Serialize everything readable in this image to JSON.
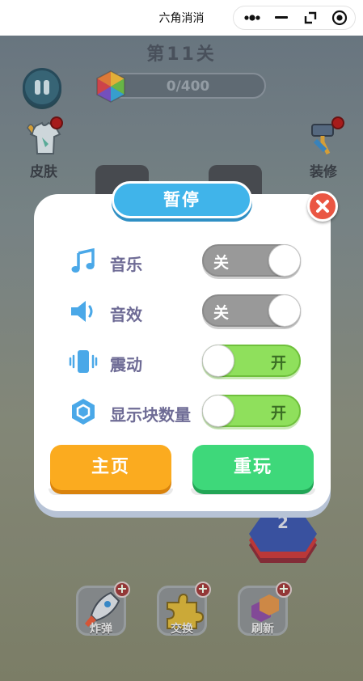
{
  "app": {
    "window_title": "六角消消"
  },
  "capsule": {
    "more_icon": "more-dots-icon",
    "minimize_icon": "minimize-icon",
    "restore_icon": "restore-icon",
    "close_icon": "target-circle-icon"
  },
  "game": {
    "level_title": "第11关",
    "progress_text": "0/400",
    "progress_value": 0,
    "progress_max": 400,
    "skin_label": "皮肤",
    "decor_label": "装修",
    "stack_count": "2",
    "tools": [
      {
        "label": "炸弹",
        "icon": "rocket-icon",
        "plus": "+"
      },
      {
        "label": "交换",
        "icon": "puzzle-icon",
        "plus": "+"
      },
      {
        "label": "刷新",
        "icon": "hexagons-icon",
        "plus": "+"
      }
    ]
  },
  "dialog": {
    "title": "暂停",
    "settings": [
      {
        "label": "音乐",
        "icon": "music-note-icon",
        "state": "off",
        "toggle_text": "关"
      },
      {
        "label": "音效",
        "icon": "speaker-icon",
        "state": "off",
        "toggle_text": "关"
      },
      {
        "label": "震动",
        "icon": "vibration-icon",
        "state": "on",
        "toggle_text": "开"
      },
      {
        "label": "显示块数量",
        "icon": "hexagon-icon",
        "state": "on",
        "toggle_text": "开"
      }
    ],
    "home_label": "主页",
    "replay_label": "重玩"
  },
  "colors": {
    "dialog_title_bg": "#40b4ea",
    "close_bg": "#ea5643",
    "home_bg": "#fbab1f",
    "replay_bg": "#3ed87a",
    "toggle_on": "#8fe05c",
    "toggle_off": "#999999",
    "label_color": "#6e6b95",
    "icon_blue": "#4aa8e8"
  }
}
